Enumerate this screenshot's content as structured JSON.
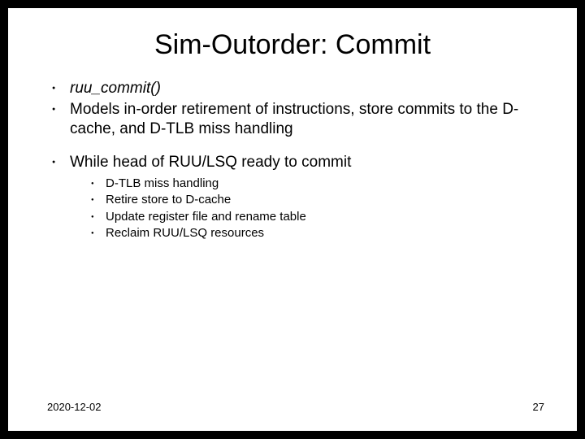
{
  "title": "Sim-Outorder: Commit",
  "bullets": {
    "b1": "ruu_commit()",
    "b2": "Models in-order retirement of instructions, store commits to the D-cache, and D-TLB miss handling",
    "b3": "While head of RUU/LSQ ready to commit",
    "sub": {
      "s1": "D-TLB miss handling",
      "s2": "Retire store to D-cache",
      "s3": "Update register file and rename table",
      "s4": "Reclaim RUU/LSQ resources"
    }
  },
  "footer": {
    "date": "2020-12-02",
    "page": "27"
  }
}
